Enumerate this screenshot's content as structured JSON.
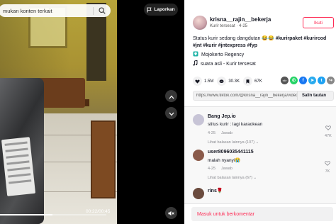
{
  "video": {
    "search_text": "mukan konten terkait",
    "report_label": "Laporkan",
    "time": "00:22/00:45",
    "progress_fraction": 0.49
  },
  "author": {
    "username": "krisna__rajin__bekerja",
    "subline": "Kurir tersesat · 4-25",
    "follow_label": "Ikuti"
  },
  "caption": {
    "text": "Status kurir sedang dangdutan 😂😂",
    "hashtags": "#kurirpaket #kurircod #jnt #kurir #jntexpress #fyp",
    "location": "Mojokerto Regency",
    "music": "suara asli - Kurir tersesat"
  },
  "stats": {
    "likes": "1.5M",
    "comments": "30.3K",
    "saves": "67K"
  },
  "share_icons": [
    {
      "name": "embed-icon",
      "glyph": "</>",
      "color": "#555"
    },
    {
      "name": "whatsapp-icon",
      "glyph": "✆",
      "color": "#25d366"
    },
    {
      "name": "facebook-icon",
      "glyph": "f",
      "color": "#1877f2"
    },
    {
      "name": "telegram-icon",
      "glyph": "➤",
      "color": "#2aabee"
    },
    {
      "name": "twitter-icon",
      "glyph": "t",
      "color": "#1da1f2"
    },
    {
      "name": "more-share-icon",
      "glyph": "↪",
      "color": "#888"
    }
  ],
  "link": {
    "url": "https://www.tiktok.com/@krisna__rajin__bekerja/video/72...",
    "copy_label": "Salin tautan"
  },
  "comments": [
    {
      "name": "Bang Jep.io",
      "text": "stitus kurir : lagi karaokean",
      "date": "4-25",
      "reply": "Jawab",
      "more_replies": "Lihat balasan lainnya (107)",
      "likes": "47K",
      "avatar_color": "#c7c4d6"
    },
    {
      "name": "user8096035441115",
      "text": "malah nyanyi😭",
      "date": "4-25",
      "reply": "Jawab",
      "more_replies": "Lihat balasan lainnya (67)",
      "likes": "7K",
      "avatar_color": "#8a5a4a"
    },
    {
      "name": "rins🌹",
      "text": "",
      "date": "",
      "reply": "",
      "more_replies": "",
      "likes": "",
      "avatar_color": "#6b4b3e"
    }
  ],
  "login": {
    "label": "Masuk untuk berkomentar"
  },
  "colors": {
    "brand": "#fe2c55",
    "text": "#161823",
    "muted": "#8a8b91"
  }
}
